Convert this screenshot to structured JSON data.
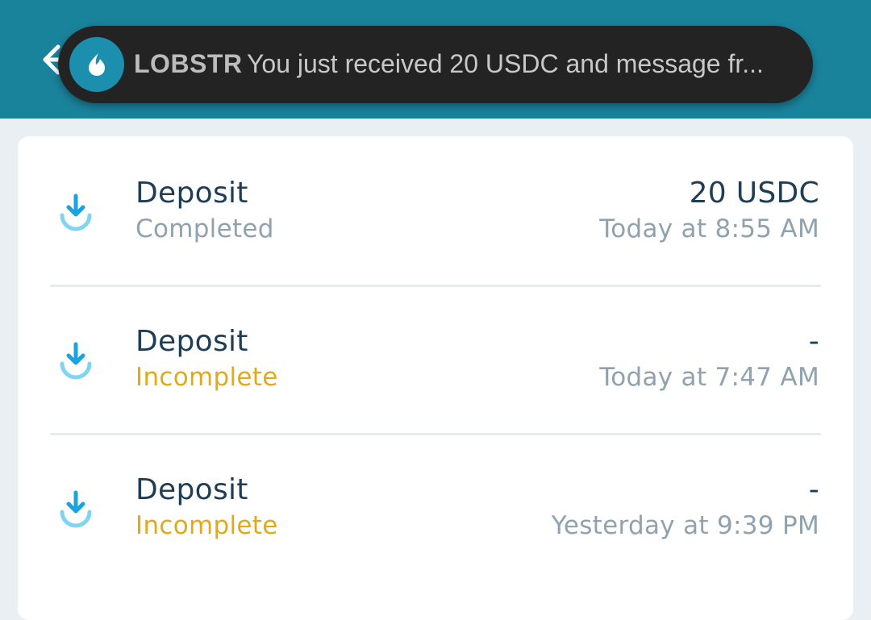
{
  "notification": {
    "app_name": "LOBSTR",
    "message": "You just received 20 USDC and message fr..."
  },
  "transactions": [
    {
      "title": "Deposit",
      "status": "Completed",
      "amount": "20 USDC",
      "time": "Today at 8:55 AM"
    },
    {
      "title": "Deposit",
      "status": "Incomplete",
      "amount": "-",
      "time": "Today at 7:47 AM"
    },
    {
      "title": "Deposit",
      "status": "Incomplete",
      "amount": "-",
      "time": "Yesterday at 9:39 PM"
    }
  ],
  "colors": {
    "app_bar": "#1a839c",
    "completed": "#8fa2ae",
    "incomplete": "#e0ab17",
    "icon": "#19a3e0"
  },
  "icons": {
    "back": "back-arrow-icon",
    "app": "lobstr-logo-icon",
    "row": "download-icon"
  }
}
